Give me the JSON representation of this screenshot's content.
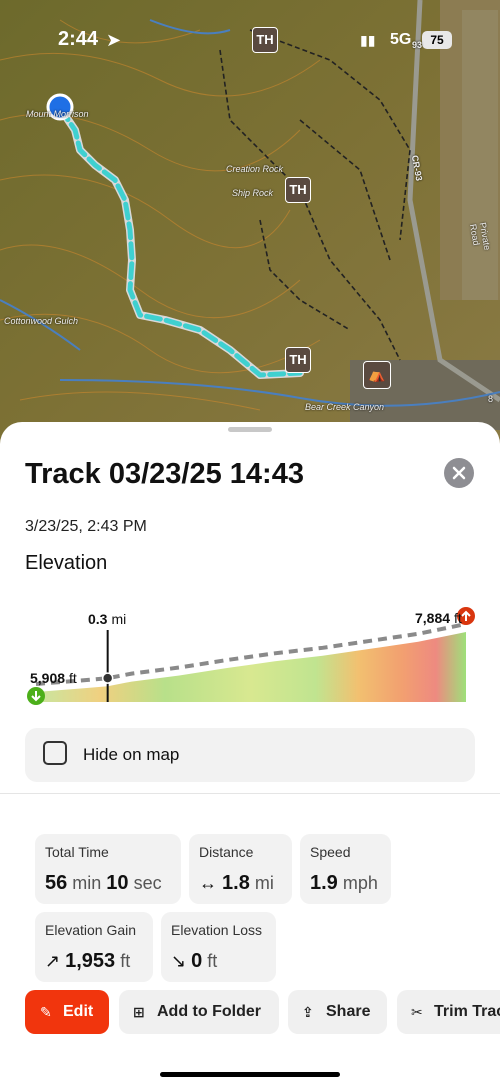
{
  "status": {
    "time": "2:44",
    "network": "5G",
    "battery": "75"
  },
  "map": {
    "markers": [
      "TH",
      "TH",
      "TH"
    ],
    "labels": [
      "Mount Morrison",
      "Creation Rock",
      "Ship Rock",
      "Cottonwood Gulch",
      "Bear Creek Canyon",
      "CR-93",
      "Private Road",
      "93",
      "8"
    ]
  },
  "sheet": {
    "title": "Track 03/23/25 14:43",
    "datetime": "3/23/25, 2:43 PM",
    "elevation_heading": "Elevation",
    "hide_on_map": "Hide on map"
  },
  "chart_data": {
    "type": "area",
    "cursor_distance": "0.3",
    "cursor_unit": "mi",
    "start_elevation": "5,908",
    "end_elevation": "7,884",
    "elevation_unit": "ft",
    "distance": [
      0,
      0.1,
      0.2,
      0.3,
      0.4,
      0.6,
      0.8,
      1.0,
      1.2,
      1.4,
      1.6,
      1.8
    ],
    "elevation": [
      5908,
      5970,
      6030,
      6100,
      6250,
      6450,
      6700,
      6920,
      7100,
      7330,
      7560,
      7884
    ]
  },
  "stats": {
    "total_time": {
      "label": "Total Time",
      "min": "56",
      "min_unit": "min",
      "sec": "10",
      "sec_unit": "sec"
    },
    "distance": {
      "label": "Distance",
      "value": "1.8",
      "unit": "mi"
    },
    "speed": {
      "label": "Speed",
      "value": "1.9",
      "unit": "mph"
    },
    "gain": {
      "label": "Elevation Gain",
      "value": "1,953",
      "unit": "ft"
    },
    "loss": {
      "label": "Elevation Loss",
      "value": "0",
      "unit": "ft"
    }
  },
  "actions": {
    "edit": "Edit",
    "add_folder": "Add to Folder",
    "share": "Share",
    "trim": "Trim Track"
  },
  "colors": {
    "accent": "#f1350d",
    "track": "#3fd0d0",
    "start": "#4caf1a",
    "end": "#d9360f"
  }
}
